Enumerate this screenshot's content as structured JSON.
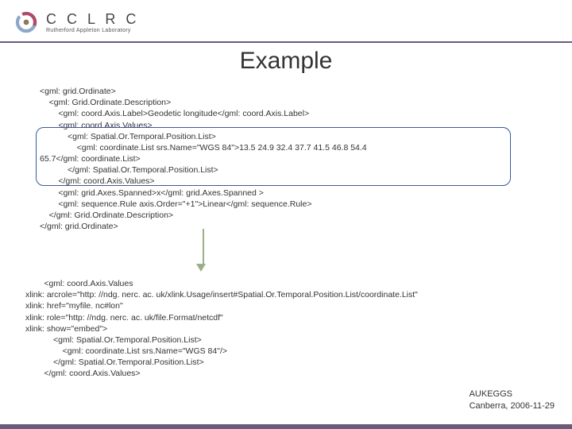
{
  "header": {
    "org_main": "C C L R C",
    "org_sub": "Rutherford Appleton Laboratory"
  },
  "title": "Example",
  "code_block_1": "<gml: grid.Ordinate>\n    <gml: Grid.Ordinate.Description>\n        <gml: coord.Axis.Label>Geodetic longitude</gml: coord.Axis.Label>\n        <gml: coord.Axis.Values>\n            <gml: Spatial.Or.Temporal.Position.List>\n                <gml: coordinate.List srs.Name=\"WGS 84\">13.5 24.9 32.4 37.7 41.5 46.8 54.4\n65.7</gml: coordinate.List>\n            </gml: Spatial.Or.Temporal.Position.List>\n        </gml: coord.Axis.Values>\n        <gml: grid.Axes.Spanned>x</gml: grid.Axes.Spanned >\n        <gml: sequence.Rule axis.Order=\"+1\">Linear</gml: sequence.Rule>\n    </gml: Grid.Ordinate.Description>\n</gml: grid.Ordinate>",
  "code_block_2": "        <gml: coord.Axis.Values\nxlink: arcrole=\"http: //ndg. nerc. ac. uk/xlink.Usage/insert#Spatial.Or.Temporal.Position.List/coordinate.List\"\nxlink: href=\"myfile. nc#lon\"\nxlink: role=\"http: //ndg. nerc. ac. uk/file.Format/netcdf\"\nxlink: show=\"embed\">\n            <gml: Spatial.Or.Temporal.Position.List>\n                <gml: coordinate.List srs.Name=\"WGS 84\"/>\n            </gml: Spatial.Or.Temporal.Position.List>\n        </gml: coord.Axis.Values>",
  "footer": {
    "line1": "AUKEGGS",
    "line2": "Canberra, 2006-11-29"
  }
}
